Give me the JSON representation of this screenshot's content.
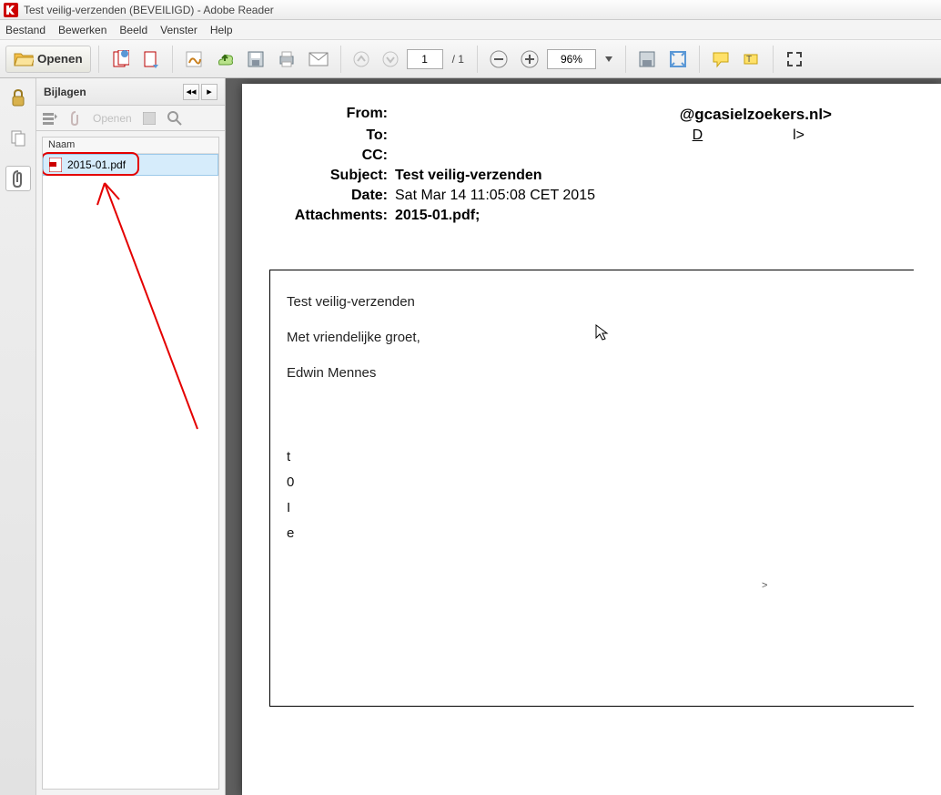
{
  "window": {
    "title": "Test veilig-verzenden (BEVEILIGD) - Adobe Reader"
  },
  "menu": {
    "file": "Bestand",
    "edit": "Bewerken",
    "view": "Beeld",
    "window": "Venster",
    "help": "Help"
  },
  "toolbar": {
    "open_label": "Openen",
    "page_current": "1",
    "page_total": "/ 1",
    "zoom": "96%"
  },
  "attachments_panel": {
    "title": "Bijlagen",
    "open_label": "Openen",
    "column_header": "Naam",
    "items": [
      {
        "filename": "2015-01.pdf"
      }
    ]
  },
  "email": {
    "labels": {
      "from": "From:",
      "to": "To:",
      "cc": "CC:",
      "subject": "Subject:",
      "date": "Date:",
      "attachments": "Attachments:"
    },
    "from": "@gcasielzoekers.nl>",
    "to_left": "D",
    "to_right": "l>",
    "cc": "",
    "subject": "Test veilig-verzenden",
    "date": "Sat Mar 14 11:05:08 CET 2015",
    "attachments": "2015-01.pdf;"
  },
  "body": {
    "line1": "Test veilig-verzenden",
    "line2": "Met vriendelijke groet,",
    "line3": "Edwin Mennes",
    "partial1": "t",
    "partial2": "0",
    "partial3": "I",
    "partial4": "e",
    "caret": ">"
  }
}
